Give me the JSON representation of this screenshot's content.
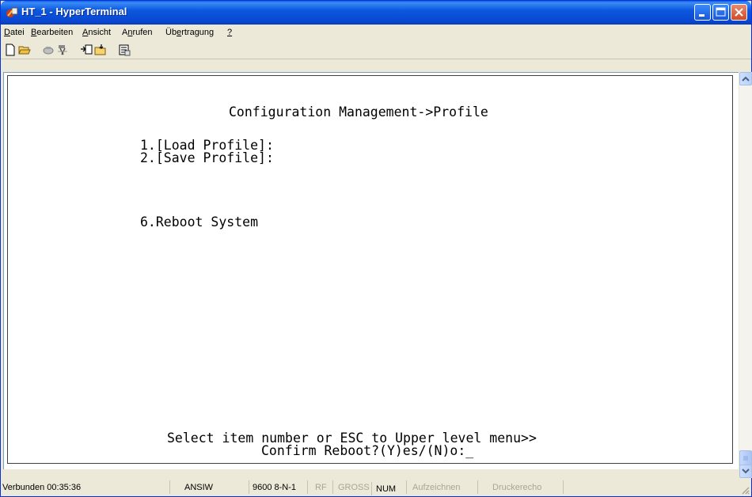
{
  "window": {
    "title": "HT_1 - HyperTerminal",
    "titlebar_color": "#0a5ee8"
  },
  "menubar": {
    "items": [
      {
        "label": "Datei",
        "accel": "D"
      },
      {
        "label": "Bearbeiten",
        "accel": "B"
      },
      {
        "label": "Ansicht",
        "accel": "A"
      },
      {
        "label": "Anrufen",
        "accel": "n"
      },
      {
        "label": "Übertragung",
        "accel": "e"
      },
      {
        "label": "?",
        "accel": "?"
      }
    ]
  },
  "toolbar": {
    "icons": [
      "new-icon",
      "open-icon",
      "call-icon",
      "disconnect-icon",
      "send-icon",
      "receive-icon",
      "properties-icon"
    ]
  },
  "terminal": {
    "heading": "Configuration Management->Profile",
    "menu_items": [
      "1.[Load Profile]:",
      "2.[Save Profile]:",
      "6.Reboot System"
    ],
    "prompt": "Select item number or ESC to Upper level menu>>",
    "confirm": "Confirm Reboot?(Y)es/(N)o:_"
  },
  "statusbar": {
    "connected": "Verbunden 00:35:36",
    "emulation": "ANSIW",
    "port_settings": "9600 8-N-1",
    "rf": "RF",
    "caps": "GROSS",
    "num": "NUM",
    "capture": "Aufzeichnen",
    "print_echo": "Druckerecho"
  }
}
